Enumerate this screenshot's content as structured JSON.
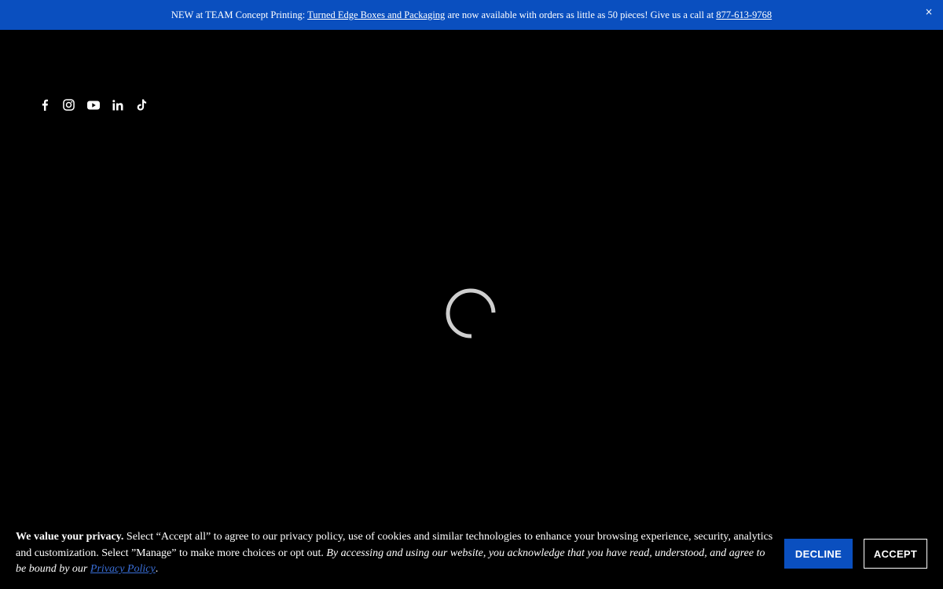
{
  "announcement": {
    "prefix": "NEW at TEAM Concept Printing: ",
    "link_text": "Turned Edge Boxes and Packaging",
    "middle": " are now available with orders as little as 50 pieces! Give us a call at ",
    "phone": "877-613-9768",
    "close_label": "×",
    "bg_color": "#0a4fbf"
  },
  "social": {
    "icons": [
      "facebook-icon",
      "instagram-icon",
      "youtube-icon",
      "linkedin-icon",
      "tiktok-icon"
    ]
  },
  "loader": {
    "icon": "loading-spinner"
  },
  "cookie_banner": {
    "heading": "We value your privacy.",
    "body": " Select “Accept all” to agree to our privacy policy, use of cookies and similar technologies to enhance your browsing experience, security, analytics and customization. Select ”Manage” to make more choices or opt out. ",
    "italic": "By accessing and using our website, you acknowledge that you have read, understood, and agree to be bound by our ",
    "policy_link": "Privacy Policy",
    "end": ".",
    "decline_label": "DECLINE",
    "accept_label": "ACCEPT",
    "link_color": "#3a6fd8"
  }
}
